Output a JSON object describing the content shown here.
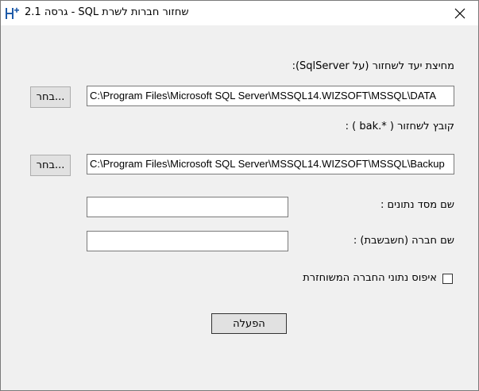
{
  "window": {
    "title": "שחזור חברות לשרת SQL - גרסה 2.1"
  },
  "form": {
    "target_folder_label": "מחיצת יעד לשחזור (על SqlServer):",
    "target_folder_value": "C:\\Program Files\\Microsoft SQL Server\\MSSQL14.WIZSOFT\\MSSQL\\DATA",
    "browse_label": "בחר...",
    "backup_file_label": "קובץ לשחזור ( *.bak ) :",
    "backup_file_value": "C:\\Program Files\\Microsoft SQL Server\\MSSQL14.WIZSOFT\\MSSQL\\Backup",
    "database_name_label": "שם מסד נתונים :",
    "database_name_value": "",
    "company_name_label": "שם חברה (חשבשבת) :",
    "company_name_value": "",
    "reset_checkbox_label": "איפוס נתוני החברה המשוחזרת",
    "reset_checked": false,
    "run_label": "הפעלה"
  },
  "colors": {
    "background": "#f0f0f0",
    "titlebar": "#ffffff",
    "icon_accent": "#1e5aa8"
  },
  "icons": {
    "app": "app-logo-icon",
    "close": "close-icon"
  }
}
